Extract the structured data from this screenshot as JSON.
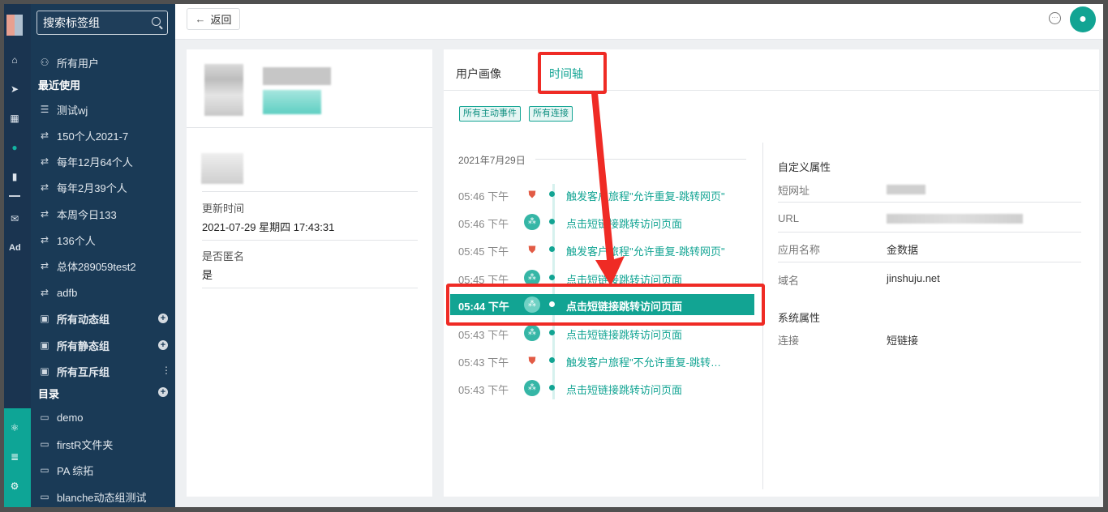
{
  "sidebar": {
    "search_placeholder": "搜索标签组",
    "all_users": "所有用户",
    "recent_header": "最近使用",
    "items": [
      "测试wj",
      "150个人2021-7",
      "每年12月64个人",
      "每年2月39个人",
      "本周今日133",
      "136个人",
      "总体289059test2",
      "adfb"
    ],
    "groups": [
      "所有动态组",
      "所有静态组",
      "所有互斥组"
    ],
    "catalog_header": "目录",
    "folders": [
      "demo",
      "firstR文件夹",
      "PA 综拓",
      "blanche动态组测试"
    ]
  },
  "topbar": {
    "back_label": "返回"
  },
  "profile": {
    "update_time_label": "更新时间",
    "update_time_value": "2021-07-29 星期四 17:43:31",
    "anonymous_label": "是否匿名",
    "anonymous_value": "是"
  },
  "tabs": {
    "portrait": "用户画像",
    "timeline": "时间轴"
  },
  "filters": [
    "所有主动事件",
    "所有连接"
  ],
  "timeline": {
    "date": "2021年7月29日",
    "events": [
      {
        "time": "05:46 下午",
        "type": "journey",
        "text": "触发客户旅程\"允许重复-跳转网页\""
      },
      {
        "time": "05:46 下午",
        "type": "link",
        "text": "点击短链接跳转访问页面"
      },
      {
        "time": "05:45 下午",
        "type": "journey",
        "text": "触发客户旅程\"允许重复-跳转网页\""
      },
      {
        "time": "05:45 下午",
        "type": "link",
        "text": "点击短链接跳转访问页面"
      },
      {
        "time": "05:44 下午",
        "type": "link",
        "text": "点击短链接跳转访问页面",
        "active": true
      },
      {
        "time": "05:43 下午",
        "type": "link",
        "text": "点击短链接跳转访问页面"
      },
      {
        "time": "05:43 下午",
        "type": "journey",
        "text": "触发客户旅程\"不允许重复-跳转网..."
      },
      {
        "time": "05:43 下午",
        "type": "link",
        "text": "点击短链接跳转访问页面"
      }
    ]
  },
  "properties": {
    "custom_header": "自定义属性",
    "short_url_label": "短网址",
    "url_label": "URL",
    "app_name_label": "应用名称",
    "app_name_value": "金数据",
    "domain_label": "域名",
    "domain_value": "jinshuju.net",
    "system_header": "系统属性",
    "connect_label": "连接",
    "connect_value": "短链接"
  },
  "colors": {
    "accent": "#12a493",
    "sidebar": "#1a3a56",
    "annotation": "#ef2b25"
  }
}
